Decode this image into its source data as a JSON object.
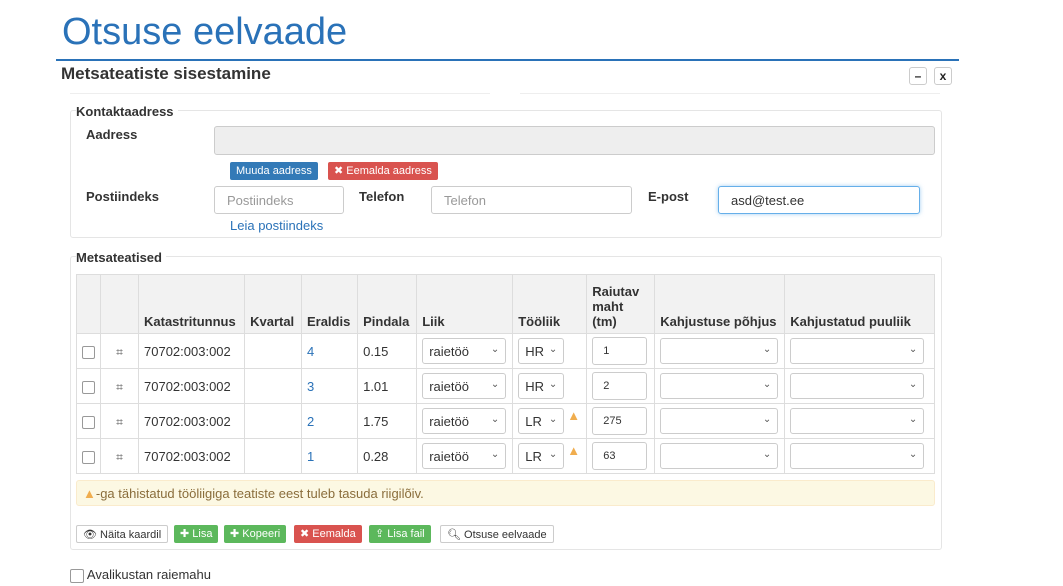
{
  "page_title": "Otsuse eelvaade",
  "modal": {
    "title": "Metsateatiste sisestamine",
    "minimize_label": "–",
    "close_label": "x"
  },
  "contact": {
    "legend": "Kontaktaadress",
    "address_label": "Aadress",
    "address_value": "",
    "change_address_button": "Muuda aadress",
    "remove_address_button": "Eemalda aadress",
    "postal_label": "Postiindeks",
    "postal_placeholder": "Postiindeks",
    "find_postal_link": "Leia postiindeks",
    "phone_label": "Telefon",
    "phone_placeholder": "Telefon",
    "email_label": "E-post",
    "email_value": "asd@test.ee"
  },
  "notices": {
    "legend": "Metsateatised",
    "columns": [
      "",
      "",
      "Katastritunnus",
      "Kvartal",
      "Eraldis",
      "Pindala",
      "Liik",
      "Tööliik",
      "Raiutav maht (tm)",
      "Kahjustuse põhjus",
      "Kahjustatud puuliik"
    ],
    "rows": [
      {
        "katastritunnus": "70702:003:002",
        "kvartal": "",
        "eraldis": "4",
        "pindala": "0.15",
        "liik": "raietöö",
        "tooliik": "HR",
        "maht": "1",
        "warn": false
      },
      {
        "katastritunnus": "70702:003:002",
        "kvartal": "",
        "eraldis": "3",
        "pindala": "1.01",
        "liik": "raietöö",
        "tooliik": "HR",
        "maht": "2",
        "warn": false
      },
      {
        "katastritunnus": "70702:003:002",
        "kvartal": "",
        "eraldis": "2",
        "pindala": "1.75",
        "liik": "raietöö",
        "tooliik": "LR",
        "maht": "275",
        "warn": true
      },
      {
        "katastritunnus": "70702:003:002",
        "kvartal": "",
        "eraldis": "1",
        "pindala": "0.28",
        "liik": "raietöö",
        "tooliik": "LR",
        "maht": "63",
        "warn": true
      }
    ],
    "alert_text": "-ga tähistatud tööliigiga teatiste eest tuleb tasuda riigilõiv."
  },
  "toolbar": {
    "show_map": "Näita kaardil",
    "add": "Lisa",
    "copy": "Kopeeri",
    "remove": "Eemalda",
    "add_file": "Lisa fail",
    "decision_preview": "Otsuse eelvaade"
  },
  "public_volume_label": "Avalikustan raiemahu",
  "colors": {
    "accent": "#2a72b8",
    "danger": "#d9534f",
    "success": "#5cb85c",
    "warning": "#f0ad4e"
  }
}
